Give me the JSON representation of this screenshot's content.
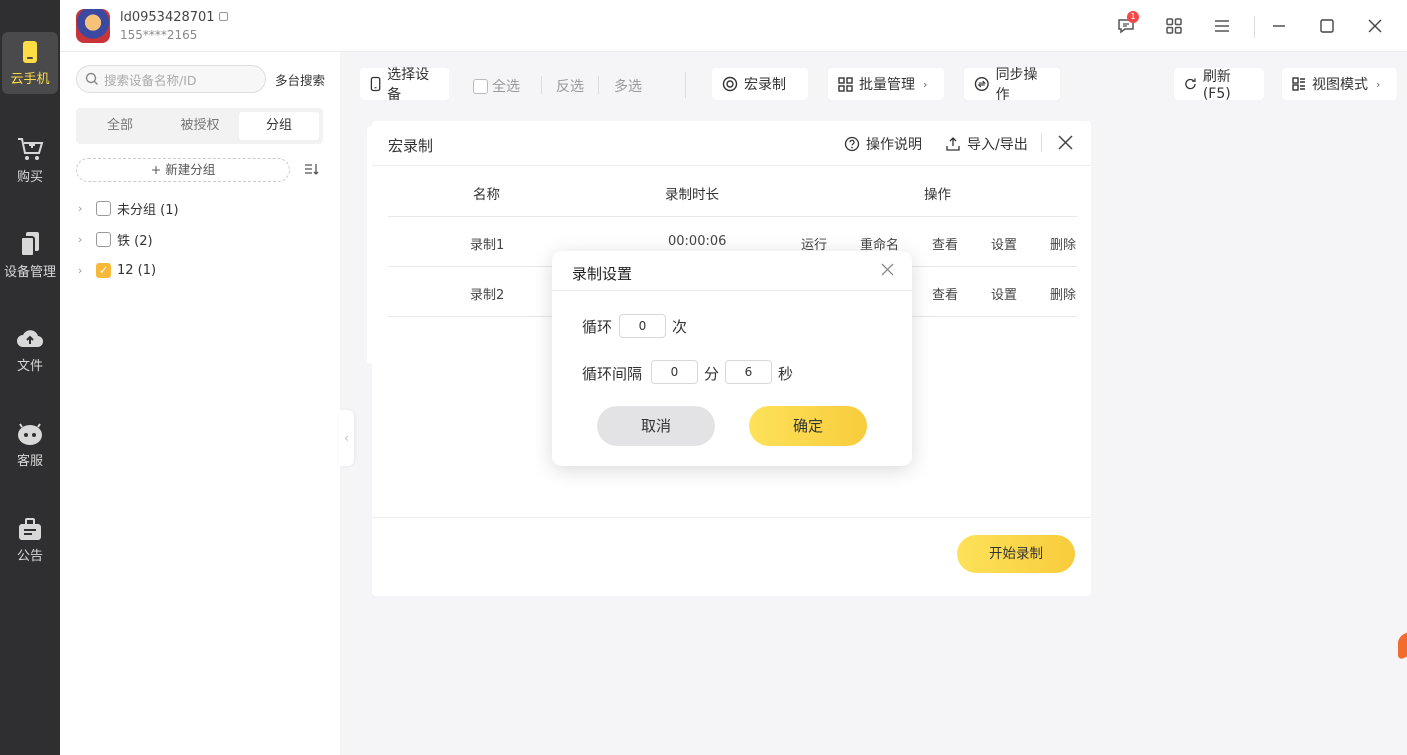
{
  "rail": {
    "items": [
      {
        "label": "云手机",
        "icon": "phone-icon"
      },
      {
        "label": "购买",
        "icon": "cart-icon"
      },
      {
        "label": "设备管理",
        "icon": "devices-icon"
      },
      {
        "label": "文件",
        "icon": "cloud-upload-icon"
      },
      {
        "label": "客服",
        "icon": "support-icon"
      },
      {
        "label": "公告",
        "icon": "announcement-icon"
      }
    ],
    "accent": "#fddc44"
  },
  "account": {
    "id": "ld0953428701",
    "phone": "155****2165"
  },
  "topbar": {
    "notification_count": "1"
  },
  "sidebar": {
    "search_placeholder": "搜索设备名称/ID",
    "multi_search": "多台搜索",
    "tabs": [
      "全部",
      "被授权",
      "分组"
    ],
    "active_tab": "分组",
    "new_group": "+ 新建分组",
    "groups": [
      {
        "label": "未分组 (1)",
        "checked": false
      },
      {
        "label": "铁 (2)",
        "checked": false
      },
      {
        "label": "12 (1)",
        "checked": true
      }
    ]
  },
  "toolbar": {
    "select_device": "选择设备",
    "select_all": "全选",
    "invert": "反选",
    "multi": "多选",
    "macro": "宏录制",
    "batch": "批量管理",
    "sync": "同步操作",
    "refresh": "刷新(F5)",
    "view_mode": "视图模式"
  },
  "macro_panel": {
    "title": "宏录制",
    "help": "操作说明",
    "import_export": "导入/导出",
    "columns": [
      "名称",
      "录制时长",
      "操作"
    ],
    "rows": [
      {
        "name": "录制1",
        "duration": "00:00:06",
        "actions": [
          "运行",
          "重命名",
          "查看",
          "设置",
          "删除"
        ]
      },
      {
        "name": "录制2",
        "duration": "",
        "actions": [
          "查看",
          "设置",
          "删除"
        ]
      }
    ],
    "start_button": "开始录制"
  },
  "modal": {
    "title": "录制设置",
    "loop_label": "循环",
    "loop_value": "0",
    "loop_unit": "次",
    "interval_label": "循环间隔",
    "interval_min": "0",
    "min_unit": "分",
    "interval_sec": "6",
    "sec_unit": "秒",
    "cancel": "取消",
    "ok": "确定"
  }
}
